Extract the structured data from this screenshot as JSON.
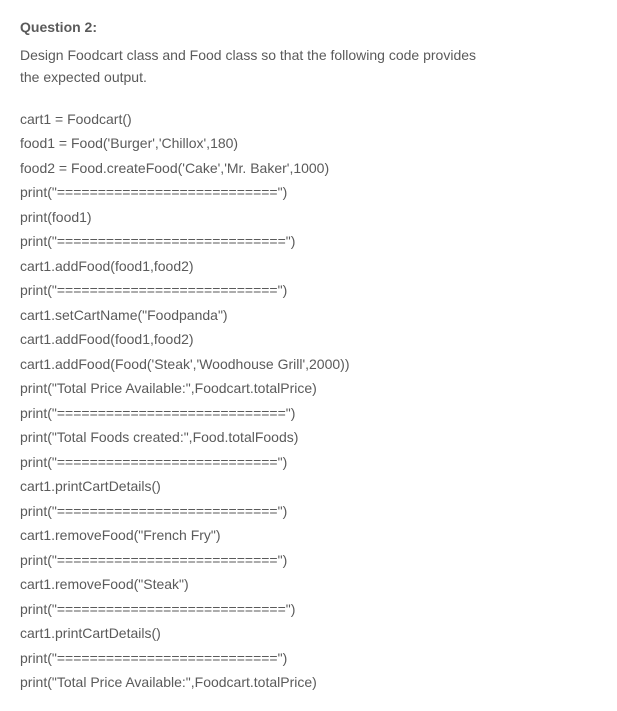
{
  "header": {
    "label": "Question 2:"
  },
  "description": {
    "line1": "Design Foodcart class and Food class so that the following code provides",
    "line2": "the expected output."
  },
  "code": {
    "lines": [
      "cart1 = Foodcart()",
      "food1 = Food('Burger','Chillox',180)",
      "food2 = Food.createFood('Cake','Mr. Baker',1000)",
      "print(\"===========================\")",
      "print(food1)",
      "print(\"============================\")",
      "cart1.addFood(food1,food2)",
      "print(\"===========================\")",
      "cart1.setCartName(\"Foodpanda\")",
      "cart1.addFood(food1,food2)",
      "cart1.addFood(Food('Steak','Woodhouse Grill',2000))",
      "print(\"Total Price Available:\",Foodcart.totalPrice)",
      "print(\"============================\")",
      "print(\"Total Foods created:\",Food.totalFoods)",
      "print(\"===========================\")",
      "cart1.printCartDetails()",
      "print(\"===========================\")",
      "cart1.removeFood(\"French Fry\")",
      "print(\"===========================\")",
      "cart1.removeFood(\"Steak\")",
      "print(\"============================\")",
      "cart1.printCartDetails()",
      "print(\"===========================\")",
      "print(\"Total Price Available:\",Foodcart.totalPrice)"
    ]
  }
}
